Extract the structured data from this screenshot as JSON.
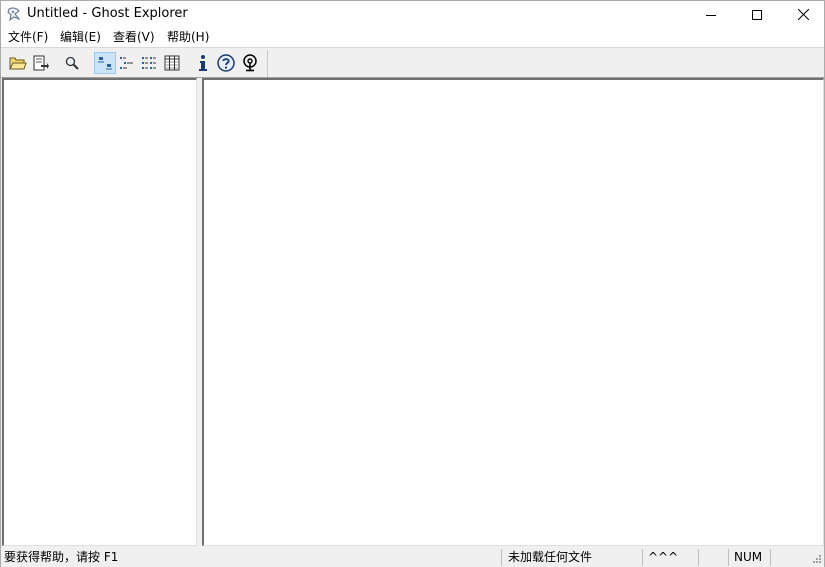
{
  "window": {
    "title": "Untitled - Ghost Explorer",
    "app_icon": "ghost-app-icon",
    "controls": [
      "minimize-icon",
      "maximize-icon",
      "close-icon"
    ]
  },
  "menubar": {
    "items": [
      {
        "label": "文件(F)"
      },
      {
        "label": "编辑(E)"
      },
      {
        "label": "查看(V)"
      },
      {
        "label": "帮助(H)"
      }
    ]
  },
  "toolbar": {
    "buttons": [
      {
        "icon": "open-folder-icon"
      },
      {
        "icon": "extract-icon"
      },
      {
        "icon": "find-icon"
      },
      {
        "icon": "large-icons-view-icon",
        "pressed": true
      },
      {
        "icon": "small-icons-view-icon"
      },
      {
        "icon": "list-view-icon"
      },
      {
        "icon": "details-view-icon"
      },
      {
        "icon": "info-icon"
      },
      {
        "icon": "help-icon"
      },
      {
        "icon": "context-help-icon"
      }
    ]
  },
  "statusbar": {
    "message": "要获得帮助，请按 F1",
    "file_status": "未加载任何文件",
    "caps_indicator": "^^^",
    "num_indicator": "NUM"
  }
}
